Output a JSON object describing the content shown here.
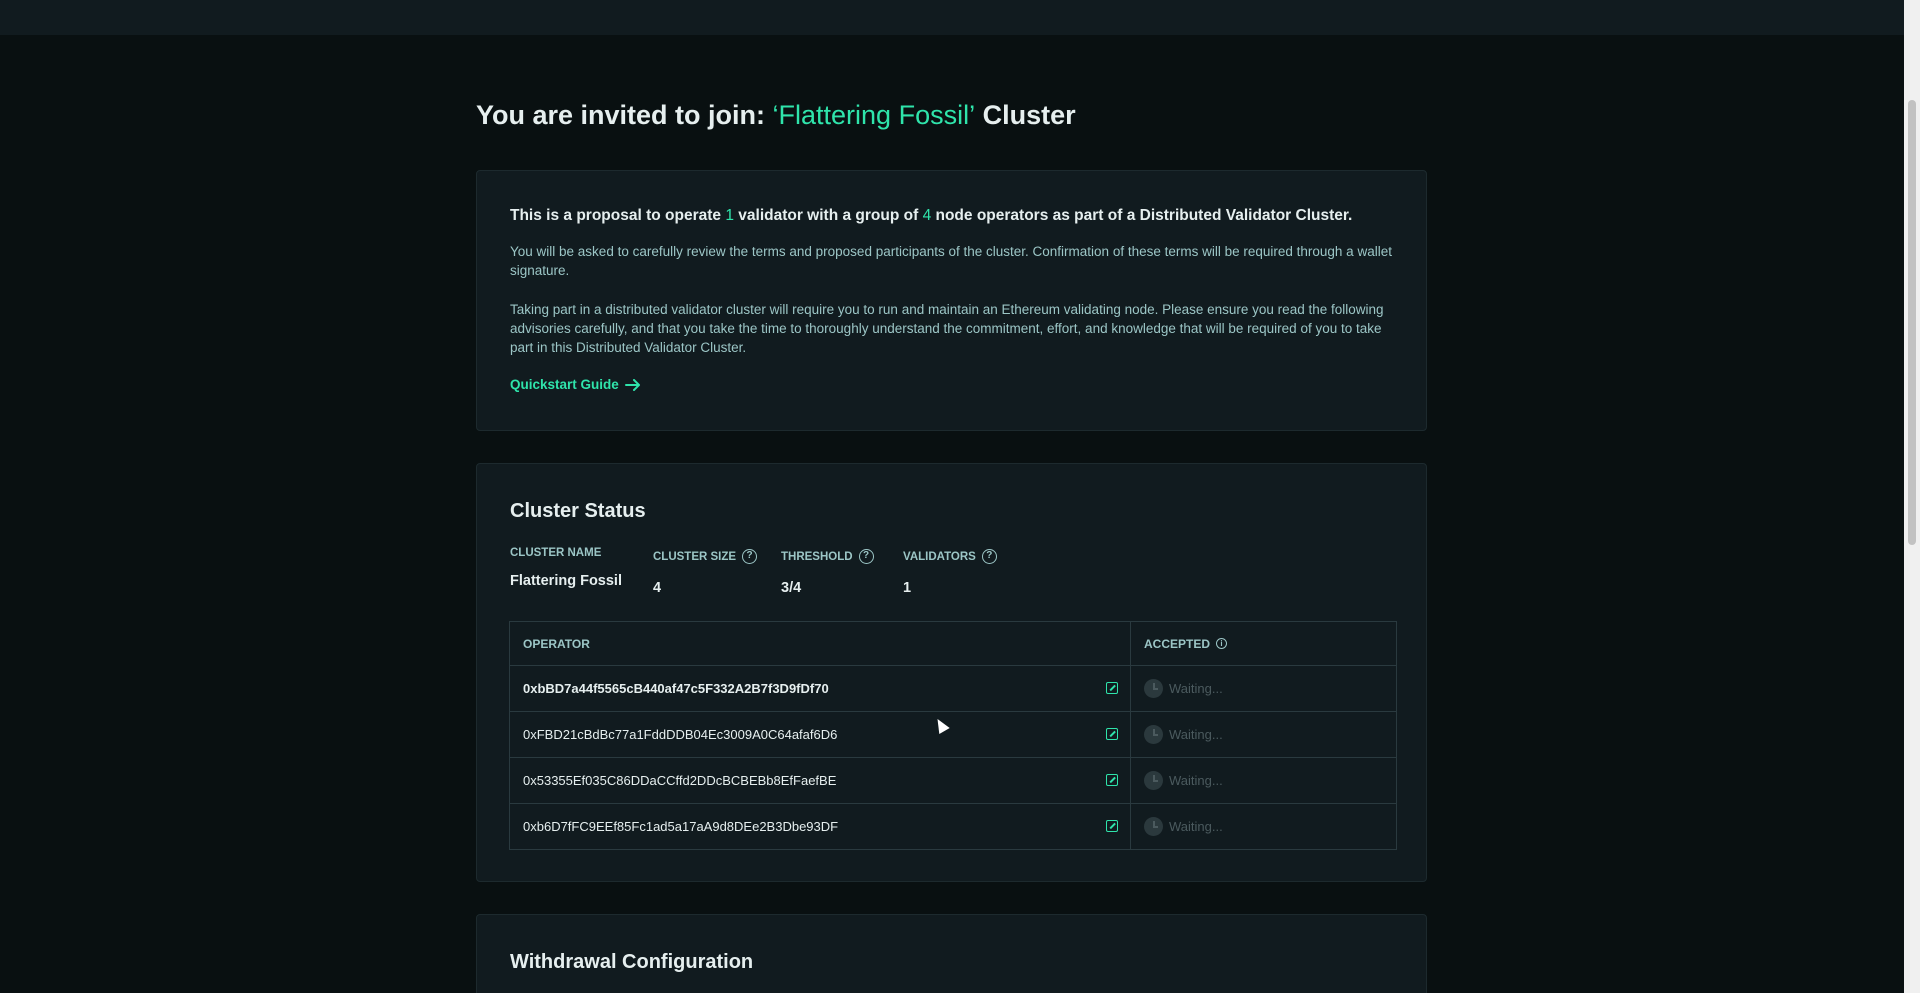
{
  "page": {
    "title_prefix": "You are invited to join:",
    "title_cluster": "‘Flattering Fossil’",
    "title_suffix": "Cluster"
  },
  "intro": {
    "headline_a": "This is a proposal to operate",
    "validators_count": "1",
    "headline_b": "validator with a group of",
    "operators_count": "4",
    "headline_c": "node operators as part of a Distributed Validator Cluster.",
    "para1": "You will be asked to carefully review the terms and proposed participants of the cluster. Confirmation of these terms will be required through a wallet signature.",
    "para2": "Taking part in a distributed validator cluster will require you to run and maintain an Ethereum validating node. Please ensure you read the following advisories carefully, and that you take the time to thoroughly understand the commitment, effort, and knowledge that will be required of you to take part in this Distributed Validator Cluster.",
    "quickstart_label": "Quickstart Guide"
  },
  "status": {
    "title": "Cluster Status",
    "cluster_name_label": "CLUSTER NAME",
    "cluster_name": "Flattering Fossil",
    "cluster_size_label": "CLUSTER SIZE",
    "cluster_size": "4",
    "threshold_label": "THRESHOLD",
    "threshold": "3/4",
    "validators_label": "VALIDATORS",
    "validators": "1",
    "table": {
      "col_operator": "OPERATOR",
      "col_accepted": "ACCEPTED",
      "rows": [
        {
          "address": "0xbBD7a44f5565cB440af47c5F332A2B7f3D9fDf70",
          "status": "Waiting..."
        },
        {
          "address": "0xFBD21cBdBc77a1FddDDB04Ec3009A0C64afaf6D6",
          "status": "Waiting..."
        },
        {
          "address": "0x53355Ef035C86DDaCCffd2DDcBCBEBb8EfFaefBE",
          "status": "Waiting..."
        },
        {
          "address": "0xb6D7fFC9EEf85Fc1ad5a17aA9d8DEe2B3Dbe93DF",
          "status": "Waiting..."
        }
      ]
    }
  },
  "withdraw": {
    "title": "Withdrawal Configuration"
  },
  "colors": {
    "accent": "#2fe4ab",
    "background": "#091011",
    "card": "#111b1f"
  },
  "icons": {
    "help": "question-circle-icon",
    "info": "info-circle-icon",
    "external": "external-link-icon",
    "waiting": "clock-icon",
    "arrow": "arrow-right-icon"
  }
}
